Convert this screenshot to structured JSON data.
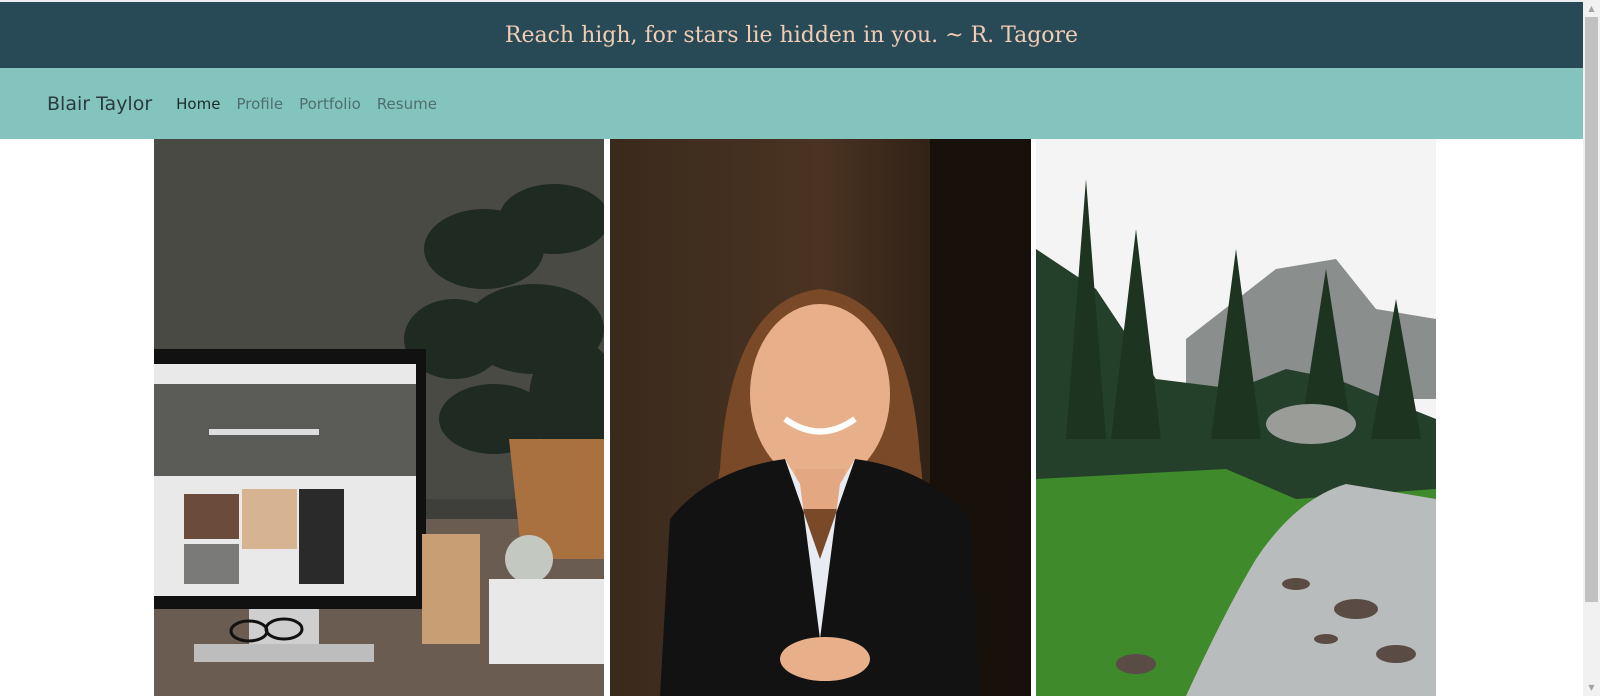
{
  "quote_bar": {
    "text": "Reach high, for stars lie hidden in you. ~ R. Tagore"
  },
  "navbar": {
    "brand": "Blair Taylor",
    "links": [
      {
        "label": "Home",
        "active": true
      },
      {
        "label": "Profile",
        "active": false
      },
      {
        "label": "Portfolio",
        "active": false
      },
      {
        "label": "Resume",
        "active": false
      }
    ]
  },
  "gallery": {
    "photos": [
      {
        "subject": "desk-workspace-photo"
      },
      {
        "subject": "portrait-photo"
      },
      {
        "subject": "mountain-stream-photo"
      }
    ]
  },
  "colors": {
    "quote_bar_bg": "#284956",
    "quote_text": "#f2cdb4",
    "navbar_bg": "#84c4bf"
  }
}
